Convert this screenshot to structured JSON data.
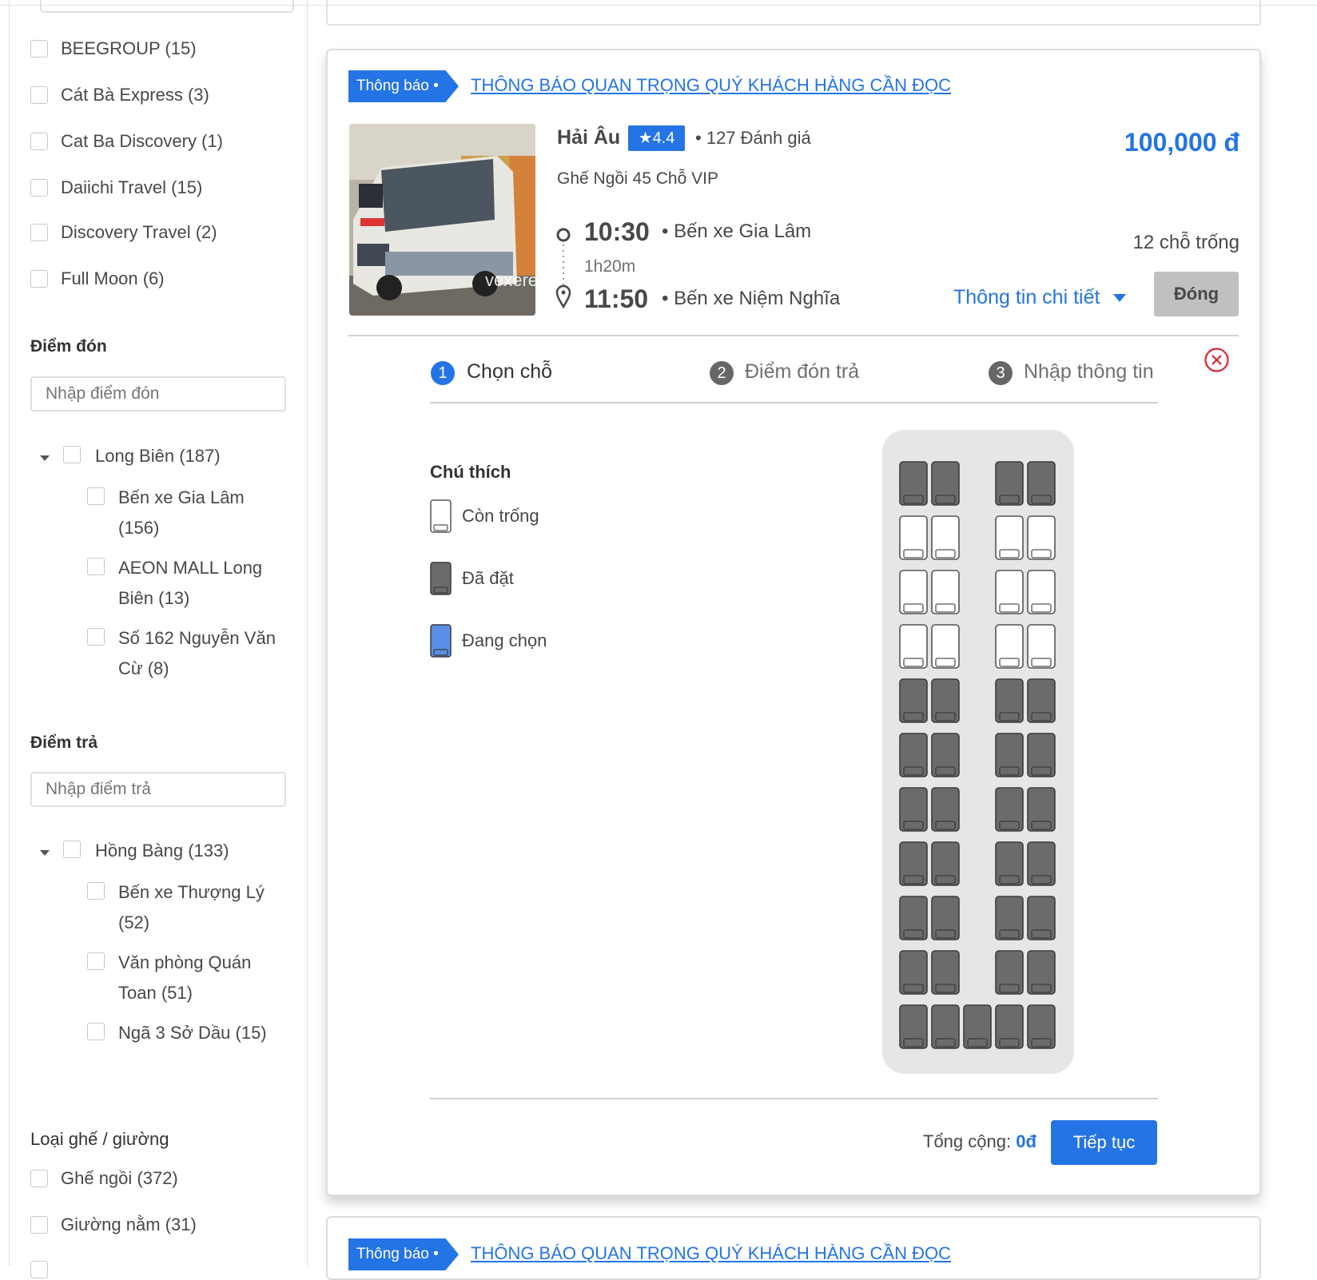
{
  "sidebar": {
    "operators": [
      {
        "label": "BEEGROUP (15)"
      },
      {
        "label": "Cát Bà Express (3)"
      },
      {
        "label": "Cat Ba Discovery (1)"
      },
      {
        "label": "Daiichi Travel (15)"
      },
      {
        "label": "Discovery Travel (2)"
      },
      {
        "label": "Full Moon (6)"
      }
    ],
    "pickup": {
      "heading": "Điểm đón",
      "placeholder": "Nhập điểm đón",
      "group": "Long Biên (187)",
      "items": [
        {
          "label": "Bến xe Gia Lâm (156)"
        },
        {
          "label": "AEON MALL Long Biên (13)"
        },
        {
          "label": "Số 162 Nguyễn Văn Cừ (8)"
        }
      ]
    },
    "dropoff": {
      "heading": "Điểm trả",
      "placeholder": "Nhập điểm trả",
      "group": "Hồng Bàng (133)",
      "items": [
        {
          "label": "Bến xe Thượng Lý (52)"
        },
        {
          "label": "Văn phòng Quán Toan (51)"
        },
        {
          "label": "Ngã 3 Sở Dầu (15)"
        }
      ]
    },
    "seat_type": {
      "heading": "Loại ghế / giường",
      "items": [
        {
          "label": "Ghế ngồi (372)"
        },
        {
          "label": "Giường nằm (31)"
        }
      ]
    }
  },
  "trip": {
    "notice_tag": "Thông báo •",
    "notice_link": "THÔNG BÁO QUAN TRỌNG QUÝ KHÁCH HÀNG CẦN ĐỌC",
    "operator": "Hải Âu",
    "rating": "4.4",
    "reviews": "• 127 Đánh giá",
    "seat_type": "Ghế Ngồi 45 Chỗ VIP",
    "price": "100,000 đ",
    "depart_time": "10:30",
    "depart_place": "• Bến xe Gia Lâm",
    "duration": "1h20m",
    "arrive_time": "11:50",
    "arrive_place": "• Bến xe Niệm Nghĩa",
    "seats_left": "12 chỗ trống",
    "detail_link": "Thông tin chi tiết",
    "close_label": "Đóng",
    "image_caption": "vexere"
  },
  "steps": [
    {
      "num": "1",
      "label": "Chọn chỗ",
      "active": true
    },
    {
      "num": "2",
      "label": "Điểm đón trả",
      "active": false
    },
    {
      "num": "3",
      "label": "Nhập thông tin",
      "active": false
    }
  ],
  "legend": {
    "title": "Chú thích",
    "available": "Còn trống",
    "booked": "Đã đặt",
    "selecting": "Đang chọn"
  },
  "seat_rows": [
    [
      "booked",
      "booked",
      "booked",
      "booked"
    ],
    [
      "available",
      "available",
      "available",
      "available"
    ],
    [
      "available",
      "available",
      "available",
      "available"
    ],
    [
      "available",
      "available",
      "available",
      "available"
    ],
    [
      "booked",
      "booked",
      "booked",
      "booked"
    ],
    [
      "booked",
      "booked",
      "booked",
      "booked"
    ],
    [
      "booked",
      "booked",
      "booked",
      "booked"
    ],
    [
      "booked",
      "booked",
      "booked",
      "booked"
    ],
    [
      "booked",
      "booked",
      "booked",
      "booked"
    ],
    [
      "booked",
      "booked",
      "booked",
      "booked"
    ],
    [
      "booked",
      "booked",
      "booked",
      "booked",
      "booked"
    ]
  ],
  "colors": {
    "primary": "#2474e5",
    "booked": "#6b6b6b",
    "selecting": "#5b8ee6",
    "close_red": "#d9232d"
  },
  "summary": {
    "total_label": "Tổng cộng:",
    "total_value": "0đ",
    "continue_label": "Tiếp tục"
  }
}
